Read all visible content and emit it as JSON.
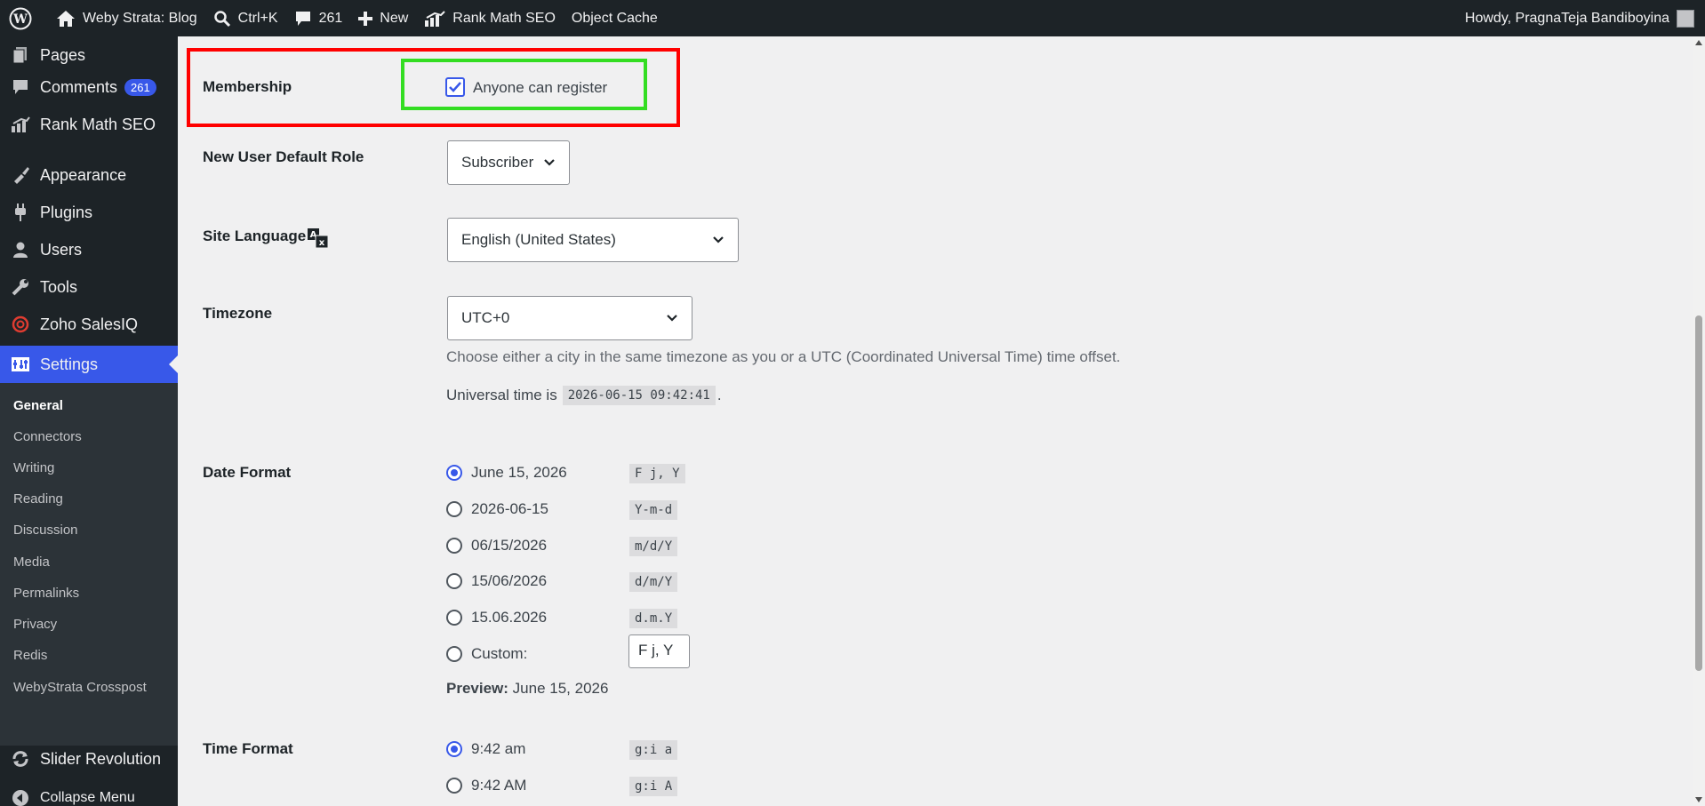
{
  "adminbar": {
    "site_name": "Weby Strata: Blog",
    "search_shortcut": "Ctrl+K",
    "comments_count": "261",
    "new_label": "New",
    "rank_math": "Rank Math SEO",
    "object_cache": "Object Cache",
    "howdy": "Howdy, PragnaTeja Bandiboyina"
  },
  "sidebar": {
    "items": [
      {
        "label": "Pages",
        "icon": "pages-icon"
      },
      {
        "label": "Comments",
        "icon": "comments-icon",
        "badge": "261"
      },
      {
        "label": "Rank Math SEO",
        "icon": "rank-math-icon"
      },
      {
        "label": "Appearance",
        "icon": "brush-icon"
      },
      {
        "label": "Plugins",
        "icon": "plugin-icon"
      },
      {
        "label": "Users",
        "icon": "user-icon"
      },
      {
        "label": "Tools",
        "icon": "wrench-icon"
      },
      {
        "label": "Zoho SalesIQ",
        "icon": "zoho-icon"
      },
      {
        "label": "Settings",
        "icon": "settings-icon"
      }
    ],
    "submenu": [
      "General",
      "Connectors",
      "Writing",
      "Reading",
      "Discussion",
      "Media",
      "Permalinks",
      "Privacy",
      "Redis",
      "WebyStrata Crosspost"
    ],
    "bottom": [
      {
        "label": "Slider Revolution",
        "icon": "refresh-icon"
      },
      {
        "label": "Collapse Menu",
        "icon": "collapse-icon"
      }
    ]
  },
  "settings": {
    "membership_label": "Membership",
    "membership_checkbox": "Anyone can register",
    "role_label": "New User Default Role",
    "role_value": "Subscriber",
    "language_label": "Site Language",
    "language_value": "English (United States)",
    "timezone_label": "Timezone",
    "timezone_value": "UTC+0",
    "timezone_desc": "Choose either a city in the same timezone as you or a UTC (Coordinated Universal Time) time offset.",
    "universal_prefix": "Universal time is",
    "universal_time": "2026-06-15 09:42:41",
    "universal_suffix": ".",
    "date_label": "Date Format",
    "date_formats": [
      {
        "label": "June 15, 2026",
        "code": "F j, Y"
      },
      {
        "label": "2026-06-15",
        "code": "Y-m-d"
      },
      {
        "label": "06/15/2026",
        "code": "m/d/Y"
      },
      {
        "label": "15/06/2026",
        "code": "d/m/Y"
      },
      {
        "label": "15.06.2026",
        "code": "d.m.Y"
      }
    ],
    "custom_label": "Custom:",
    "custom_value": "F j, Y",
    "preview_label": "Preview:",
    "preview_value": "June 15, 2026",
    "time_label": "Time Format",
    "time_formats": [
      {
        "label": "9:42 am",
        "code": "g:i a"
      },
      {
        "label": "9:42 AM",
        "code": "g:i A"
      }
    ]
  },
  "colors": {
    "accent": "#3858e9",
    "highlight_red": "#ff0000",
    "highlight_green": "#33dd22"
  }
}
